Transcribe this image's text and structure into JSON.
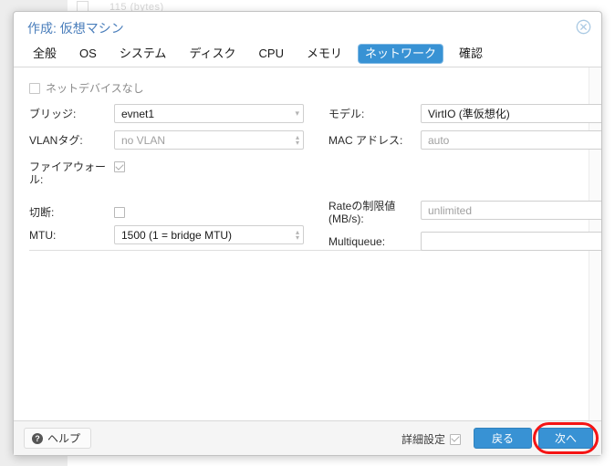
{
  "background": {
    "ghost_text": "115 (bytes)"
  },
  "dialog": {
    "title": "作成: 仮想マシン",
    "close_icon": "close-circle-icon"
  },
  "tabs": [
    {
      "label": "全般",
      "active": false
    },
    {
      "label": "OS",
      "active": false
    },
    {
      "label": "システム",
      "active": false
    },
    {
      "label": "ディスク",
      "active": false
    },
    {
      "label": "CPU",
      "active": false
    },
    {
      "label": "メモリ",
      "active": false
    },
    {
      "label": "ネットワーク",
      "active": true
    },
    {
      "label": "確認",
      "active": false
    }
  ],
  "form": {
    "no_network_device": {
      "label": "ネットデバイスなし",
      "checked": false
    },
    "bridge": {
      "label": "ブリッジ:",
      "value": "evnet1",
      "is_placeholder": false,
      "arrow": "chevron-down-icon"
    },
    "vlan_tag": {
      "label": "VLANタグ:",
      "value": "no VLAN",
      "is_placeholder": true
    },
    "firewall": {
      "label_line1": "ファイアウォー",
      "label_line2": "ル:",
      "checked": true
    },
    "model": {
      "label": "モデル:",
      "value": "VirtIO (準仮想化)",
      "is_placeholder": false,
      "arrow": "chevron-down-icon"
    },
    "mac_address": {
      "label": "MAC アドレス:",
      "value": "auto",
      "is_placeholder": true
    },
    "disconnect": {
      "label": "切断:",
      "checked": false
    },
    "mtu": {
      "label": "MTU:",
      "value": "1500 (1 = bridge MTU)",
      "is_placeholder": false
    },
    "rate_limit": {
      "label_line1": "Rateの制限値",
      "label_line2": "(MB/s):",
      "value": "unlimited",
      "is_placeholder": true
    },
    "multiqueue": {
      "label": "Multiqueue:",
      "value": "",
      "is_placeholder": true
    }
  },
  "footer": {
    "help_label": "ヘルプ",
    "help_icon": "question-mark-icon",
    "advanced_label": "詳細設定",
    "advanced_checked": true,
    "back_label": "戻る",
    "next_label": "次へ",
    "next_highlight_color": "#f51414"
  },
  "colors": {
    "accent": "#3892d4",
    "title": "#4a7ebb",
    "highlight": "#f51414"
  }
}
